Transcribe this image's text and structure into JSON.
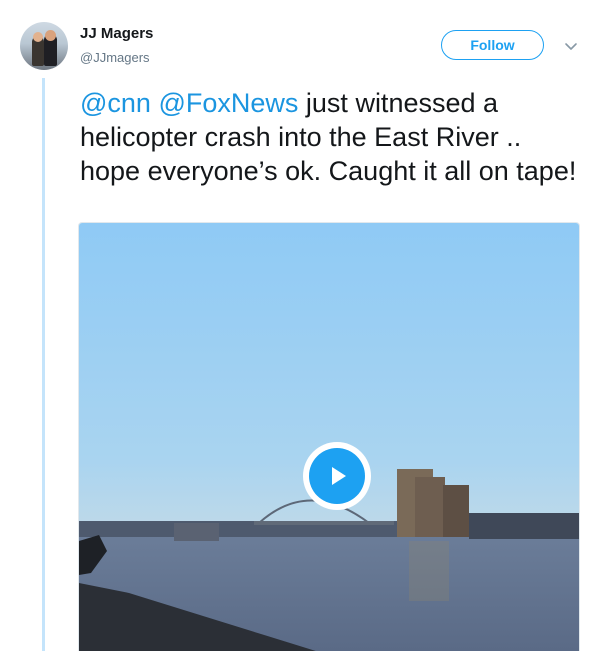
{
  "user": {
    "name": "JJ Magers",
    "handle": "@JJmagers",
    "follow_label": "Follow"
  },
  "tweet": {
    "mention1": "@cnn",
    "mention2": "@FoxNews",
    "text": "just witnessed a helicopter crash into the East River .. hope everyone’s ok. Caught it all on tape!"
  },
  "colors": {
    "accent": "#1da1f2",
    "mention": "#1b95e0",
    "text": "#14171a",
    "muted": "#657786",
    "thread_line": "#c4e4fb"
  },
  "icons": {
    "caret": "chevron-down-icon",
    "play": "play-icon"
  }
}
